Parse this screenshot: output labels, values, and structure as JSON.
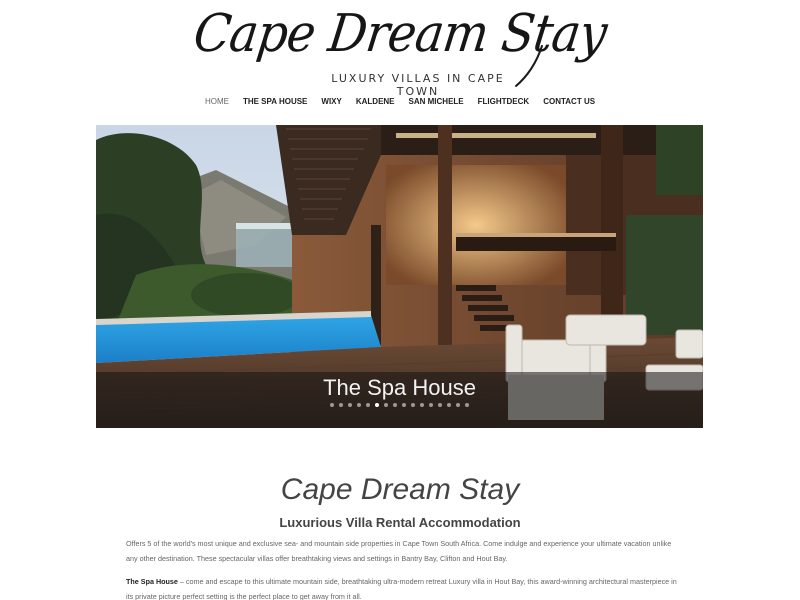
{
  "site": {
    "logo_script": "Cape Dream Stay",
    "logo_tagline": "LUXURY VILLAS IN CAPE TOWN"
  },
  "nav": {
    "items": [
      {
        "label": "HOME",
        "active": true
      },
      {
        "label": "THE SPA HOUSE"
      },
      {
        "label": "WIXY"
      },
      {
        "label": "KALDENE"
      },
      {
        "label": "SAN MICHELE"
      },
      {
        "label": "FLIGHTDECK"
      },
      {
        "label": "CONTACT US"
      }
    ]
  },
  "slider": {
    "caption": "The Spa House",
    "dot_count": 16,
    "active_dot": 5
  },
  "content": {
    "title": "Cape Dream Stay",
    "subtitle": "Luxurious Villa Rental Accommodation",
    "para1": "Offers 5 of the world's most unique and exclusive sea- and mountain side properties in Cape Town South Africa. Come indulge and experience your ultimate vacation unlike any other destination. These spectacular villas offer breathtaking views and settings in Bantry Bay, Clifton and Hout Bay.",
    "para2_bold": "The Spa House",
    "para2_rest": " – come and escape to this ultimate mountain side, breathtaking ultra-modern retreat Luxury villa in Hout Bay, this award-winning architectural masterpiece in its private picture perfect setting is the perfect place to get away from it all."
  }
}
